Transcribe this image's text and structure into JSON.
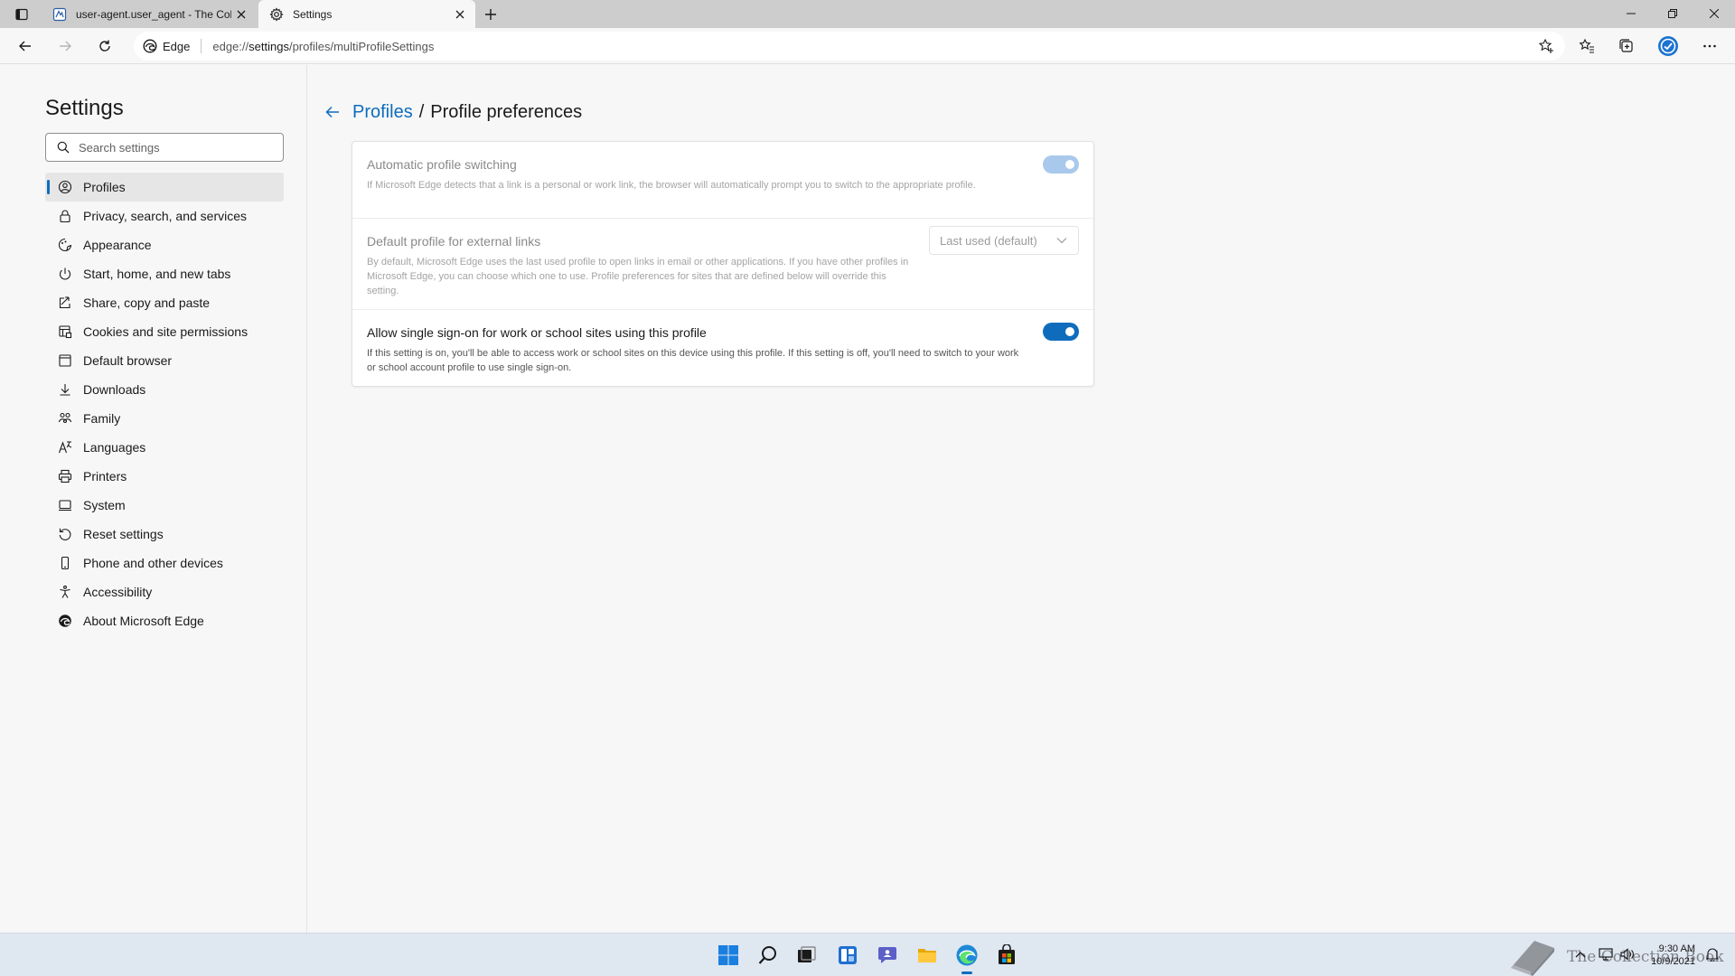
{
  "browser": {
    "tabs": [
      {
        "title": "user-agent.user_agent - The Coll",
        "active": false,
        "icon": "document-icon"
      },
      {
        "title": "Settings",
        "active": true,
        "icon": "gear-icon"
      }
    ],
    "address": {
      "site_label": "Edge",
      "url_prefix": "edge://",
      "url_host": "settings",
      "url_path": "/profiles/multiProfileSettings"
    }
  },
  "sidebar": {
    "title": "Settings",
    "search_placeholder": "Search settings",
    "items": [
      {
        "label": "Profiles",
        "icon": "profile-icon",
        "selected": true
      },
      {
        "label": "Privacy, search, and services",
        "icon": "lock-icon"
      },
      {
        "label": "Appearance",
        "icon": "appearance-icon"
      },
      {
        "label": "Start, home, and new tabs",
        "icon": "power-icon"
      },
      {
        "label": "Share, copy and paste",
        "icon": "share-icon"
      },
      {
        "label": "Cookies and site permissions",
        "icon": "cookies-icon"
      },
      {
        "label": "Default browser",
        "icon": "browser-icon"
      },
      {
        "label": "Downloads",
        "icon": "download-icon"
      },
      {
        "label": "Family",
        "icon": "family-icon"
      },
      {
        "label": "Languages",
        "icon": "languages-icon"
      },
      {
        "label": "Printers",
        "icon": "printer-icon"
      },
      {
        "label": "System",
        "icon": "system-icon"
      },
      {
        "label": "Reset settings",
        "icon": "reset-icon"
      },
      {
        "label": "Phone and other devices",
        "icon": "phone-icon"
      },
      {
        "label": "Accessibility",
        "icon": "accessibility-icon"
      },
      {
        "label": "About Microsoft Edge",
        "icon": "edge-icon"
      }
    ]
  },
  "main": {
    "breadcrumb": {
      "parent": "Profiles",
      "separator": "/",
      "current": "Profile preferences"
    },
    "settings": [
      {
        "title": "Automatic profile switching",
        "description": "If Microsoft Edge detects that a link is a personal or work link, the browser will automatically prompt you to switch to the appropriate profile.",
        "control": "toggle",
        "state": "on",
        "enabled": false
      },
      {
        "title": "Default profile for external links",
        "description": "By default, Microsoft Edge uses the last used profile to open links in email or other applications. If you have other profiles in Microsoft Edge, you can choose which one to use. Profile preferences for sites that are defined below will override this setting.",
        "control": "dropdown",
        "value": "Last used (default)",
        "enabled": false
      },
      {
        "title": "Allow single sign-on for work or school sites using this profile",
        "description": "If this setting is on, you'll be able to access work or school sites on this device using this profile. If this setting is off, you'll need to switch to your work or school account profile to use single sign-on.",
        "control": "toggle",
        "state": "on",
        "enabled": true
      }
    ]
  },
  "taskbar": {
    "pinned": [
      "start-icon",
      "search-icon",
      "task-view-icon",
      "widgets-icon",
      "chat-icon",
      "file-explorer-icon",
      "edge-icon",
      "store-icon"
    ],
    "clock_time": "9:30 AM",
    "clock_date": "10/9/2021",
    "watermark_text": "The Collection Book"
  },
  "colors": {
    "accent": "#0f6cbd",
    "toggle_disabled": "#a9c9ec",
    "tabstrip": "#cdcdcd",
    "taskbar": "#dfe7f1"
  }
}
